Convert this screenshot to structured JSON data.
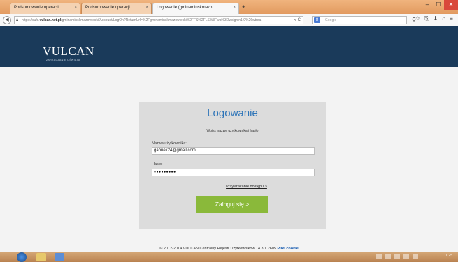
{
  "browser": {
    "tabs": [
      {
        "label": "Podsumowanie operacji",
        "active": false
      },
      {
        "label": "Podsumowanie operacji",
        "active": false
      },
      {
        "label": "Logowanie (gminaminskmazo...",
        "active": true
      }
    ],
    "tab_close": "×",
    "new_tab": "+",
    "window_buttons": {
      "minimize": "–",
      "maximize": "☐",
      "close": "✕"
    },
    "back": "◀",
    "url_prefix": "https://cufs.",
    "url_domain": "vulcan.net.pl",
    "url_rest": "/gminaminskmazowiecki/Account/LogOn?ReturnUrl=%2Fgminaminskmazowiecki%2FFS%2FLS%3Fwa%3Dwsignin1.0%26wtrea",
    "url_reload": "▿ C",
    "search_engine_badge": "8",
    "search_placeholder": "Google",
    "search_icon": "⚲",
    "toolbar_icons": {
      "star": "☆",
      "bookmarks": "⎘",
      "download": "⬇",
      "home": "⌂",
      "menu": "≡"
    }
  },
  "header": {
    "logo": "VULCAN",
    "logo_sub": "ZARZĄDZANIE OŚWIATĄ"
  },
  "login": {
    "title": "Logowanie",
    "subtitle": "Wpisz nazwę użytkownika i hasło",
    "username_label": "Nazwa użytkownika:",
    "username_value": "gabriek24@gmail.com",
    "password_label": "Hasło:",
    "password_value": "●●●●●●●●●",
    "recover_link": "Przywracanie dostępu >",
    "submit_label": "Zaloguj się >"
  },
  "footer": {
    "copyright": "© 2012-2014 VULCAN Centralny Rejestr Użytkowników 14.3.1.2605",
    "cookie_link": "Pliki cookie"
  },
  "taskbar": {
    "clock": "11:25"
  },
  "colors": {
    "header_bg": "#1a3a5a",
    "title_blue": "#2d74b8",
    "button_green": "#8ab93a"
  }
}
